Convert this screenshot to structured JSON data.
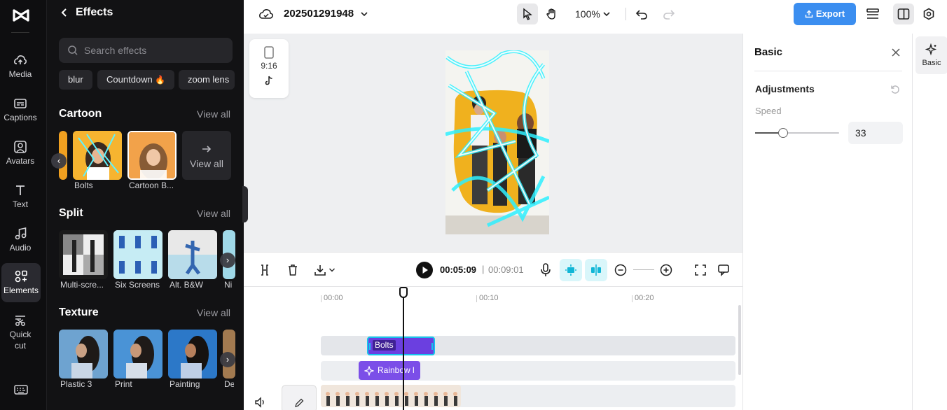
{
  "rail": {
    "items": [
      {
        "label": "Media"
      },
      {
        "label": "Captions"
      },
      {
        "label": "Avatars"
      },
      {
        "label": "Text"
      },
      {
        "label": "Audio"
      },
      {
        "label": "Elements"
      },
      {
        "label": "Quick cut"
      }
    ],
    "active": "Elements"
  },
  "effects": {
    "title": "Effects",
    "search_placeholder": "Search effects",
    "chips": [
      "blur",
      "Countdown",
      "zoom lens"
    ],
    "sections": [
      {
        "title": "Cartoon",
        "view_all": "View all",
        "items": [
          "Bolts",
          "Cartoon B..."
        ],
        "tile_label": "View all"
      },
      {
        "title": "Split",
        "view_all": "View all",
        "items": [
          "Multi-scre...",
          "Six Screens",
          "Alt. B&W",
          "Ni"
        ]
      },
      {
        "title": "Texture",
        "view_all": "View all",
        "items": [
          "Plastic 3",
          "Print",
          "Painting",
          "De"
        ]
      }
    ]
  },
  "topbar": {
    "project_name": "202501291948",
    "zoom": "100%",
    "export_label": "Export"
  },
  "canvas": {
    "ratio": "9:16"
  },
  "timeline": {
    "current_time": "00:05:09",
    "separator": "|",
    "total_time": "00:09:01",
    "ruler": [
      "00:00",
      "00:10",
      "00:20"
    ],
    "clips": {
      "bolts": "Bolts",
      "rainbow": "Rainbow l"
    }
  },
  "properties": {
    "title": "Basic",
    "section": "Adjustments",
    "speed_label": "Speed",
    "speed_value": "33",
    "speed_fraction": 0.33
  },
  "right_tabs": {
    "basic_label": "Basic"
  },
  "colors": {
    "accent": "#3b8ef0",
    "clip_purple": "#6b3fe0",
    "clip_border": "#16c4ec",
    "snap_bg": "#d9f6fa"
  }
}
